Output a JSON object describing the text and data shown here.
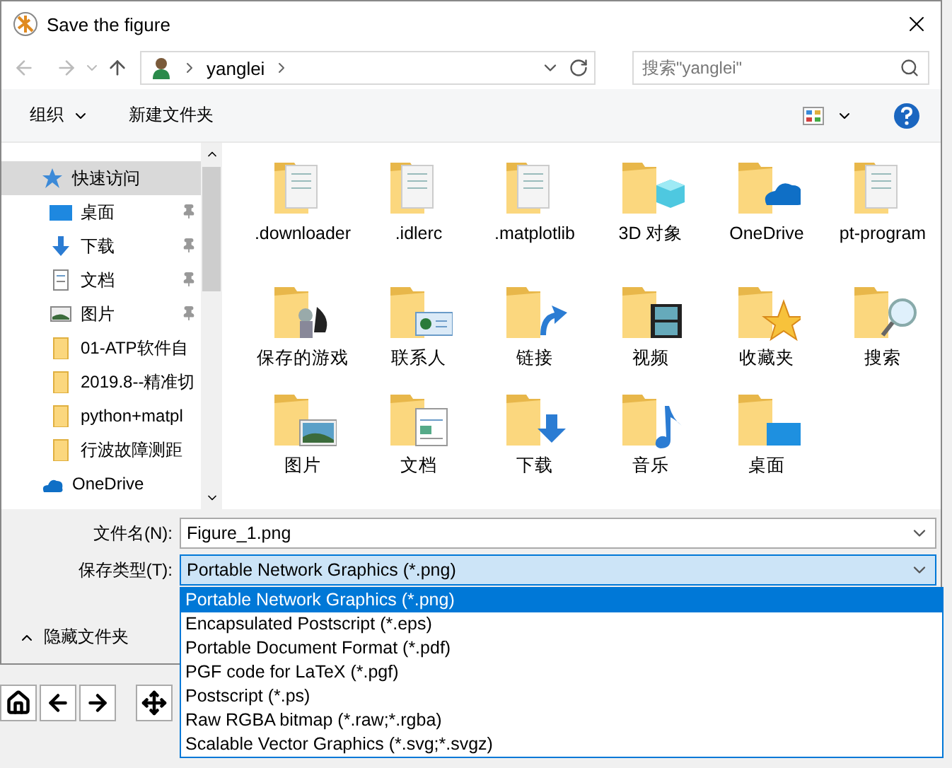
{
  "window": {
    "title": "Save the figure"
  },
  "address": {
    "path": [
      "yanglei"
    ]
  },
  "search": {
    "placeholder": "搜索\"yanglei\""
  },
  "toolbar": {
    "organize": "组织",
    "new_folder": "新建文件夹"
  },
  "sidebar": {
    "items": [
      {
        "label": "快速访问",
        "kind": "star",
        "pinned": false,
        "selected": true
      },
      {
        "label": "桌面",
        "kind": "desktop",
        "pinned": true,
        "selected": false
      },
      {
        "label": "下载",
        "kind": "download",
        "pinned": true,
        "selected": false
      },
      {
        "label": "文档",
        "kind": "document",
        "pinned": true,
        "selected": false
      },
      {
        "label": "图片",
        "kind": "picture",
        "pinned": true,
        "selected": false
      },
      {
        "label": "01-ATP软件自",
        "kind": "folder",
        "pinned": false,
        "selected": false
      },
      {
        "label": "2019.8--精准切",
        "kind": "folder",
        "pinned": false,
        "selected": false
      },
      {
        "label": "python+matpl",
        "kind": "folder",
        "pinned": false,
        "selected": false
      },
      {
        "label": "行波故障测距",
        "kind": "folder",
        "pinned": false,
        "selected": false
      },
      {
        "label": "OneDrive",
        "kind": "cloud",
        "pinned": false,
        "selected": false
      }
    ]
  },
  "files": [
    {
      "name": ".downloader",
      "kind": "papers"
    },
    {
      "name": ".idlerc",
      "kind": "papers"
    },
    {
      "name": ".matplotlib",
      "kind": "papers"
    },
    {
      "name": "3D 对象",
      "kind": "cube"
    },
    {
      "name": "OneDrive",
      "kind": "cloud"
    },
    {
      "name": "pt-program",
      "kind": "papers"
    },
    {
      "name": "保存的游戏",
      "kind": "game"
    },
    {
      "name": "联系人",
      "kind": "contact"
    },
    {
      "name": "链接",
      "kind": "link"
    },
    {
      "name": "视频",
      "kind": "video"
    },
    {
      "name": "收藏夹",
      "kind": "star"
    },
    {
      "name": "搜索",
      "kind": "search"
    },
    {
      "name": "图片",
      "kind": "picture"
    },
    {
      "name": "文档",
      "kind": "document"
    },
    {
      "name": "下载",
      "kind": "download"
    },
    {
      "name": "音乐",
      "kind": "music"
    },
    {
      "name": "桌面",
      "kind": "desktop"
    }
  ],
  "filename": {
    "label": "文件名(N):",
    "value": "Figure_1.png"
  },
  "filetype": {
    "label": "保存类型(T):",
    "value": "Portable Network Graphics (*.png)",
    "options": [
      {
        "label": "Portable Network Graphics (*.png)",
        "selected": true
      },
      {
        "label": "Encapsulated Postscript (*.eps)",
        "selected": false
      },
      {
        "label": "Portable Document Format (*.pdf)",
        "selected": false
      },
      {
        "label": "PGF code for LaTeX (*.pgf)",
        "selected": false
      },
      {
        "label": "Postscript (*.ps)",
        "selected": false
      },
      {
        "label": "Raw RGBA bitmap (*.raw;*.rgba)",
        "selected": false
      },
      {
        "label": "Scalable Vector Graphics (*.svg;*.svgz)",
        "selected": false
      }
    ]
  },
  "hide_folders": "隐藏文件夹",
  "plot_toolbar": {
    "buttons": [
      {
        "kind": "home"
      },
      {
        "kind": "back"
      },
      {
        "kind": "forward"
      },
      {
        "kind": "move"
      }
    ]
  }
}
